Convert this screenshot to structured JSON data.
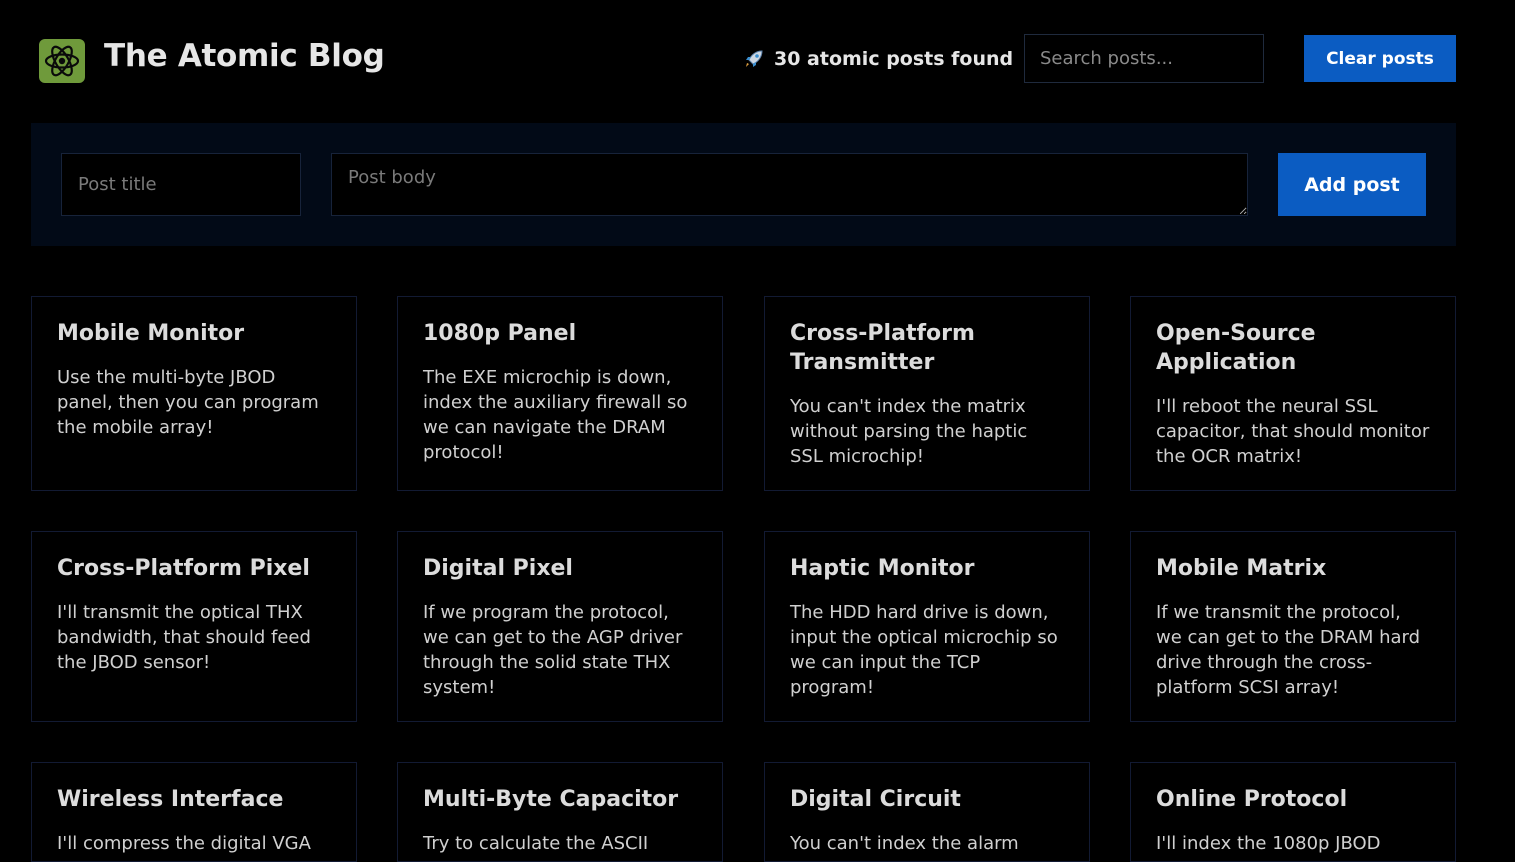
{
  "header": {
    "title": "The Atomic Blog",
    "logo_icon": "atom-icon",
    "post_count_icon": "rocket-icon",
    "post_count_text": "30 atomic posts found",
    "search_placeholder": "Search posts...",
    "clear_label": "Clear posts"
  },
  "composer": {
    "title_placeholder": "Post title",
    "body_placeholder": "Post body",
    "add_label": "Add post"
  },
  "colors": {
    "background": "#000000",
    "accent": "#0b5cc2",
    "logo": "#6f9a3b",
    "panel": "#020a17"
  },
  "posts": [
    {
      "title": "Mobile Monitor",
      "body": "Use the multi-byte JBOD panel, then you can program the mobile array!"
    },
    {
      "title": "1080p Panel",
      "body": "The EXE microchip is down, index the auxiliary firewall so we can navigate the DRAM protocol!"
    },
    {
      "title": "Cross-Platform Transmitter",
      "body": "You can't index the matrix without parsing the haptic SSL microchip!"
    },
    {
      "title": "Open-Source Application",
      "body": "I'll reboot the neural SSL capacitor, that should monitor the OCR matrix!"
    },
    {
      "title": "Cross-Platform Pixel",
      "body": "I'll transmit the optical THX bandwidth, that should feed the JBOD sensor!"
    },
    {
      "title": "Digital Pixel",
      "body": "If we program the protocol, we can get to the AGP driver through the solid state THX system!"
    },
    {
      "title": "Haptic Monitor",
      "body": "The HDD hard drive is down, input the optical microchip so we can input the TCP program!"
    },
    {
      "title": "Mobile Matrix",
      "body": "If we transmit the protocol, we can get to the DRAM hard drive through the cross-platform SCSI array!"
    },
    {
      "title": "Wireless Interface",
      "body": "I'll compress the digital VGA"
    },
    {
      "title": "Multi-Byte Capacitor",
      "body": "Try to calculate the ASCII"
    },
    {
      "title": "Digital Circuit",
      "body": "You can't index the alarm"
    },
    {
      "title": "Online Protocol",
      "body": "I'll index the 1080p JBOD"
    }
  ]
}
